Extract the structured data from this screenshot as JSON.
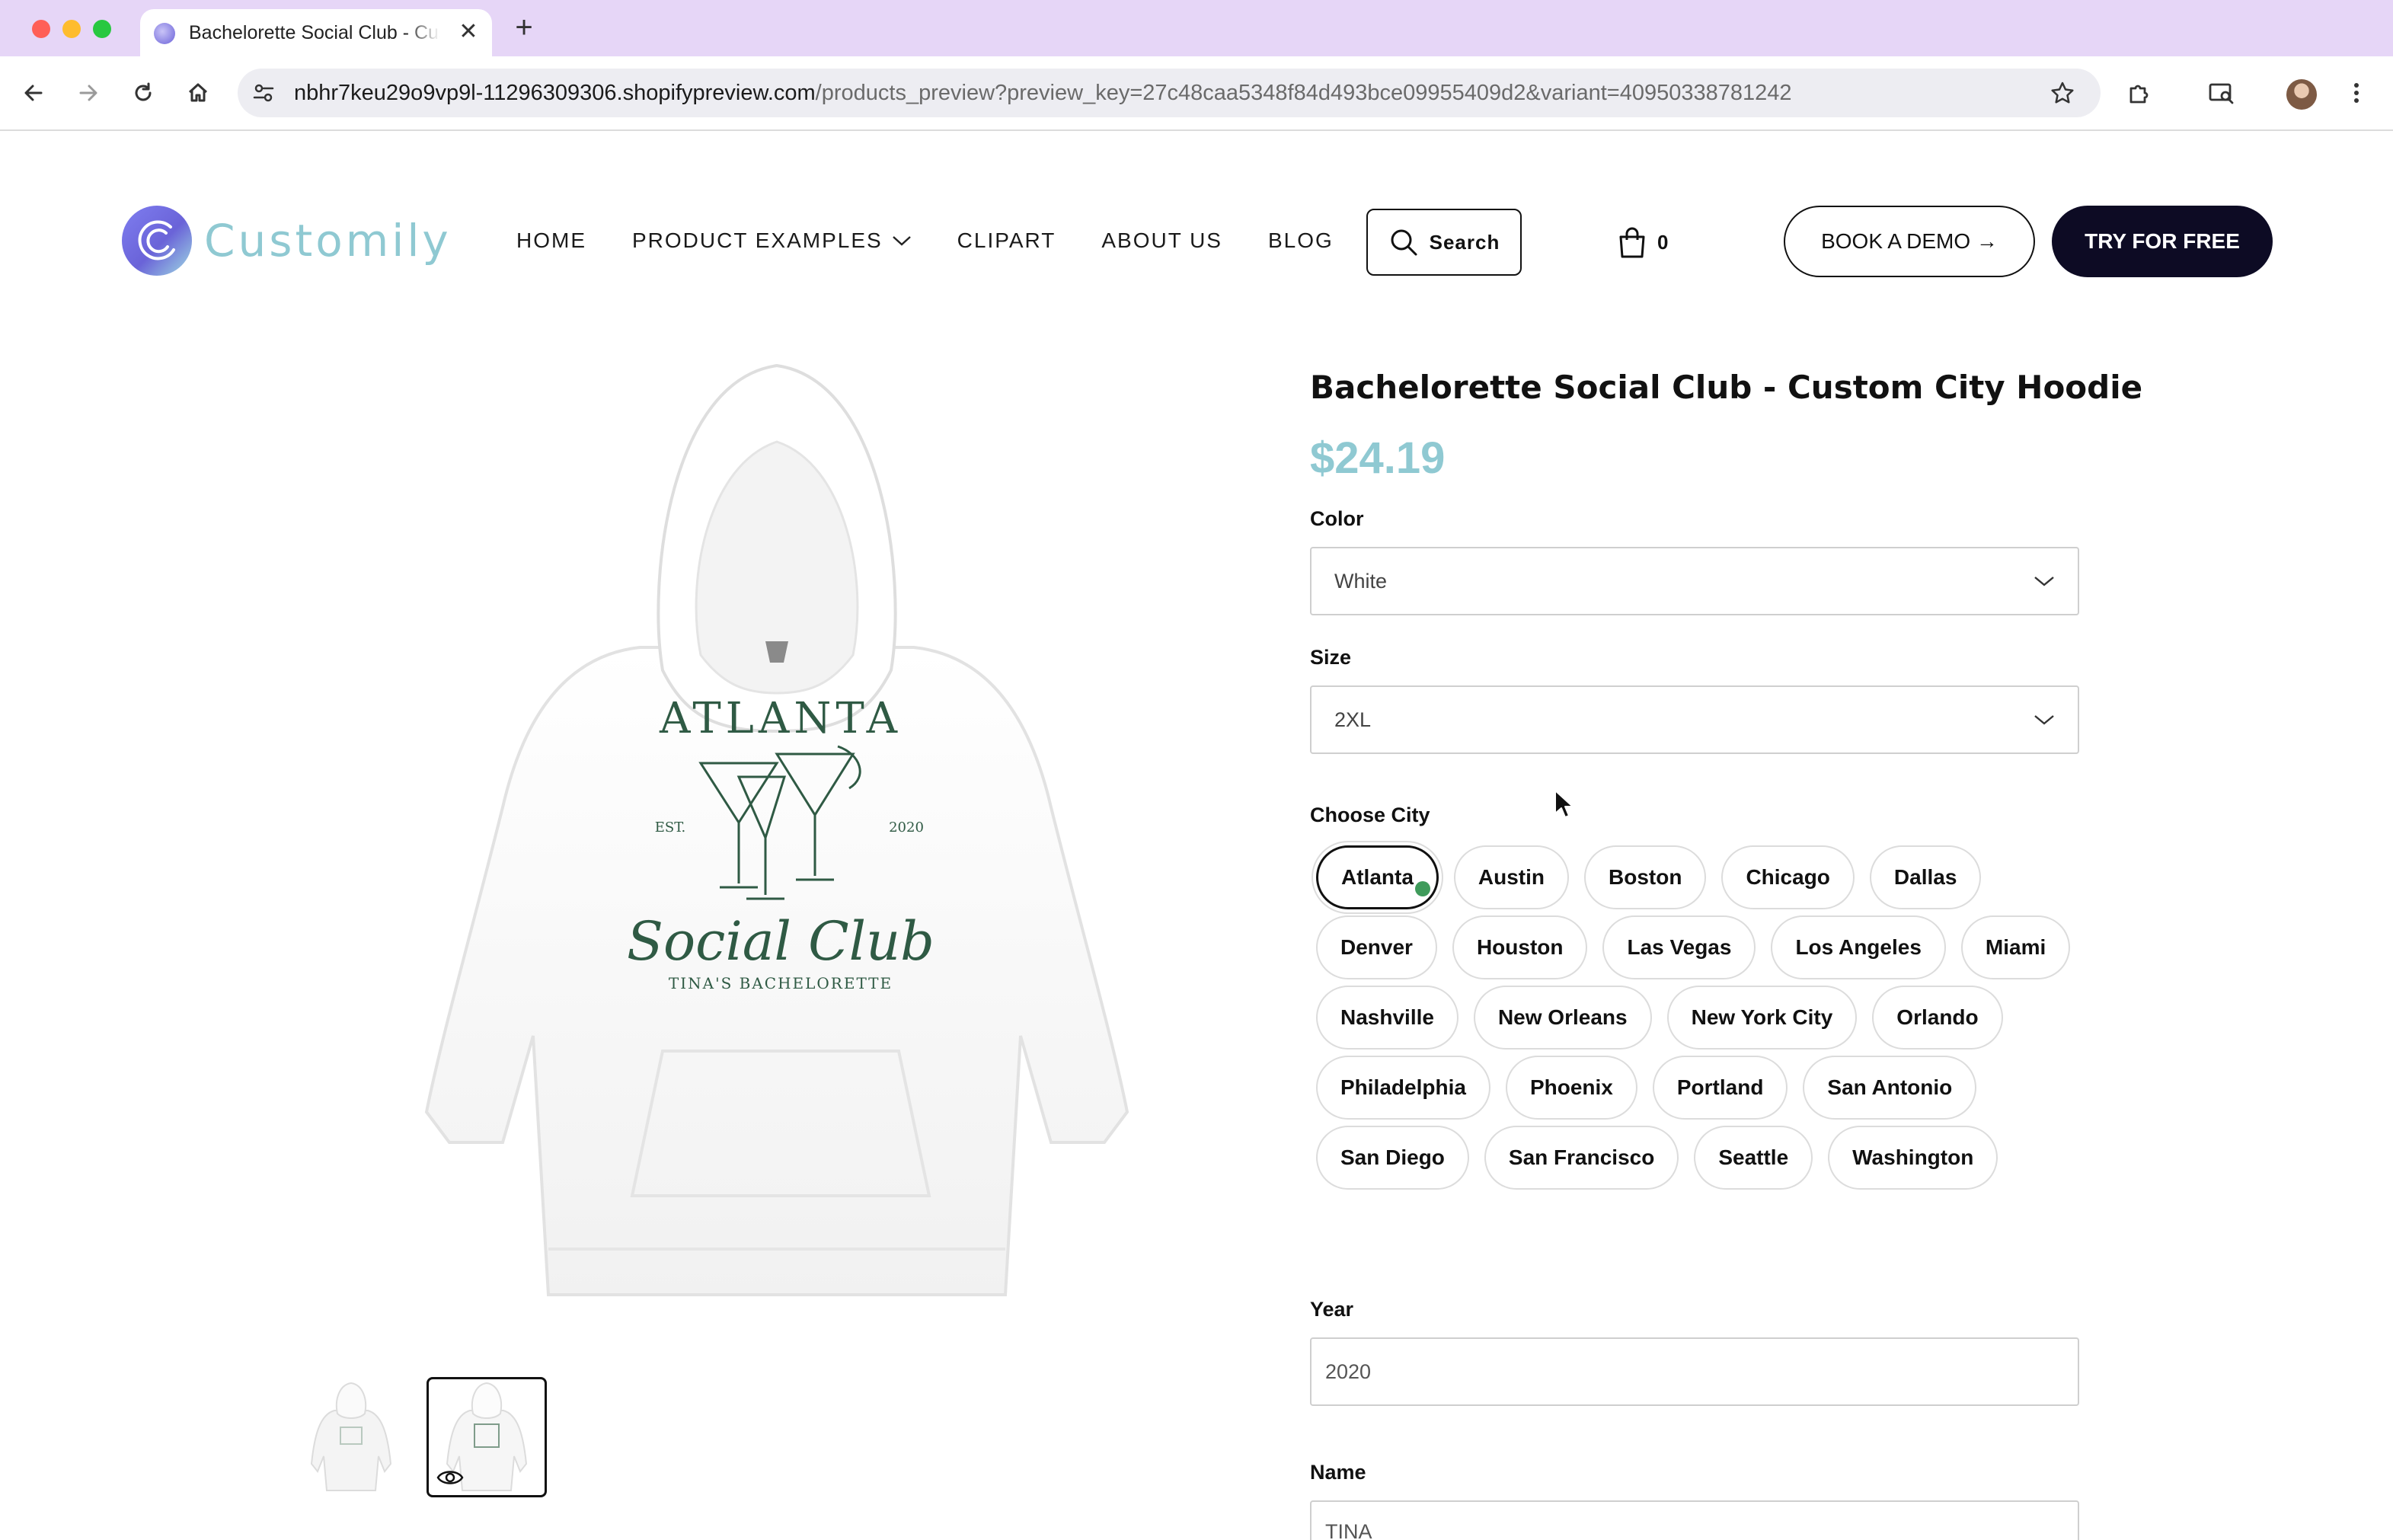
{
  "browser": {
    "tab_title": "Bachelorette Social Club - Custom City Hoodie",
    "tab_close": "✕",
    "new_tab": "+",
    "url_host": "nbhr7keu29o9vp9l-11296309306.shopifypreview.com",
    "url_path": "/products_preview?preview_key=27c48caa5348f84d493bce09955409d2&variant=40950338781242"
  },
  "header": {
    "logo_text": "Customily",
    "nav": [
      {
        "label": "HOME"
      },
      {
        "label": "PRODUCT EXAMPLES"
      },
      {
        "label": "CLIPART"
      },
      {
        "label": "ABOUT US"
      },
      {
        "label": "BLOG"
      }
    ],
    "search_label": "Search",
    "cart_count": "0",
    "demo_label": "BOOK A DEMO →",
    "try_label": "TRY FOR FREE"
  },
  "product": {
    "title": "Bachelorette Social Club - Custom City Hoodie",
    "price": "$24.19",
    "color_label": "Color",
    "color_value": "White",
    "size_label": "Size",
    "size_value": "2XL",
    "city_label": "Choose City",
    "cities": [
      "Atlanta",
      "Austin",
      "Boston",
      "Chicago",
      "Dallas",
      "Denver",
      "Houston",
      "Las Vegas",
      "Los Angeles",
      "Miami",
      "Nashville",
      "New Orleans",
      "New York City",
      "Orlando",
      "Philadelphia",
      "Phoenix",
      "Portland",
      "San Antonio",
      "San Diego",
      "San Francisco",
      "Seattle",
      "Washington"
    ],
    "selected_city": "Atlanta",
    "year_label": "Year",
    "year_value": "2020",
    "name_label": "Name",
    "name_value": "TINA"
  },
  "design": {
    "city_print": "ATLANTA",
    "est": "EST.",
    "year": "2020",
    "script": "Social Club",
    "subtitle": "TINA'S BACHELORETTE"
  },
  "colors": {
    "accent": "#8fc9d2",
    "dark": "#0d0b24",
    "print_green": "#2f5a44",
    "check_green": "#3f9b5b"
  }
}
